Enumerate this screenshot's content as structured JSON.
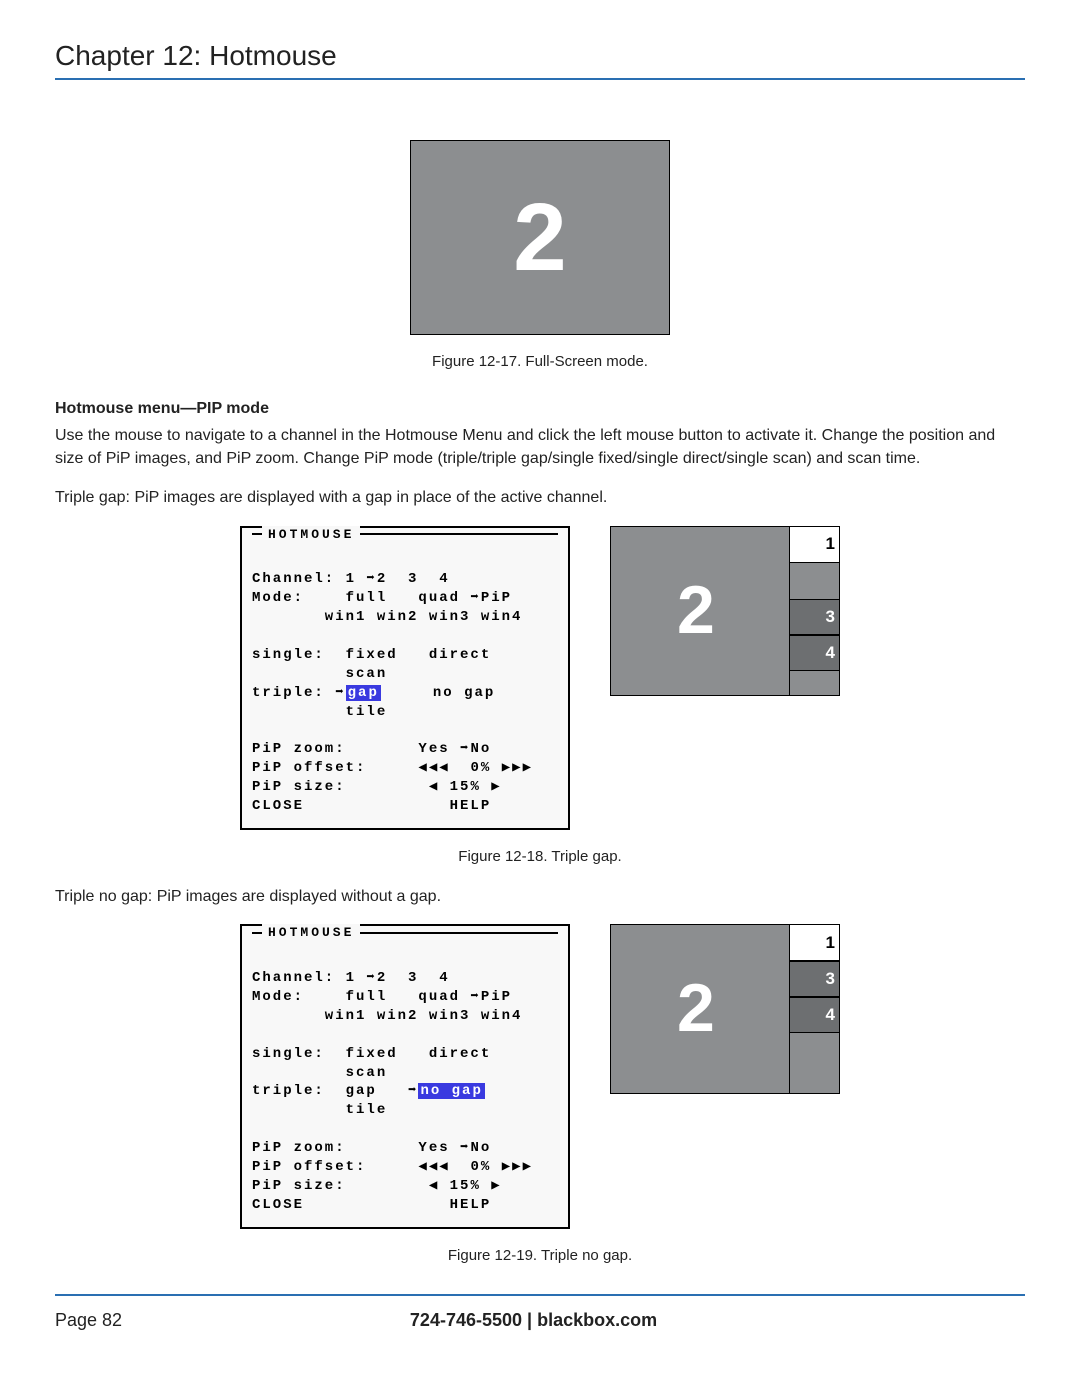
{
  "chapter_title": "Chapter 12: Hotmouse",
  "fig_fullscreen": {
    "big_number": "2",
    "caption": "Figure 12-17. Full-Screen mode."
  },
  "pip_section": {
    "subhead": "Hotmouse menu—PIP mode",
    "para1": "Use the mouse to navigate to a channel in the Hotmouse Menu and click the left mouse button to activate it. Change the position and size of PiP images, and PiP zoom. Change PiP mode (triple/triple gap/single fixed/single direct/single scan) and scan time.",
    "para2": "Triple gap: PiP images are displayed with a gap in place of the active channel."
  },
  "osd1": {
    "legend": "HOTMOUSE",
    "line_channel": "Channel: 1 ➡2  3  4",
    "line_mode": "Mode:    full   quad ➡PiP",
    "line_wins": "       win1 win2 win3 win4",
    "line_single1": "single:  fixed   direct",
    "line_single2": "         scan",
    "line_triple_pre": "triple: ➡",
    "line_triple_hl": "gap",
    "line_triple_post": "     no gap",
    "line_tile": "         tile",
    "line_zoom": "PiP zoom:       Yes ➡No",
    "line_offset": "PiP offset:     ◀◀◀  0% ▶▶▶",
    "line_size": "PiP size:        ◀ 15% ▶",
    "line_close": "CLOSE              HELP"
  },
  "preview1": {
    "main": "2",
    "pip1": "1",
    "pip3": "3",
    "pip4": "4"
  },
  "caption18": "Figure 12-18. Triple gap.",
  "para3": "Triple no gap: PiP images are displayed without a gap.",
  "osd2": {
    "legend": "HOTMOUSE",
    "line_channel": "Channel: 1 ➡2  3  4",
    "line_mode": "Mode:    full   quad ➡PiP",
    "line_wins": "       win1 win2 win3 win4",
    "line_single1": "single:  fixed   direct",
    "line_single2": "         scan",
    "line_triple_pre": "triple:  gap   ➡",
    "line_triple_hl": "no gap",
    "line_tile": "         tile",
    "line_zoom": "PiP zoom:       Yes ➡No",
    "line_offset": "PiP offset:     ◀◀◀  0% ▶▶▶",
    "line_size": "PiP size:        ◀ 15% ▶",
    "line_close": "CLOSE              HELP"
  },
  "preview2": {
    "main": "2",
    "pip1": "1",
    "pip3": "3",
    "pip4": "4"
  },
  "caption19": "Figure 12-19. Triple no gap.",
  "footer": {
    "page": "Page 82",
    "phone": "724-746-5500",
    "sep": "  |  ",
    "site": "blackbox.com"
  }
}
